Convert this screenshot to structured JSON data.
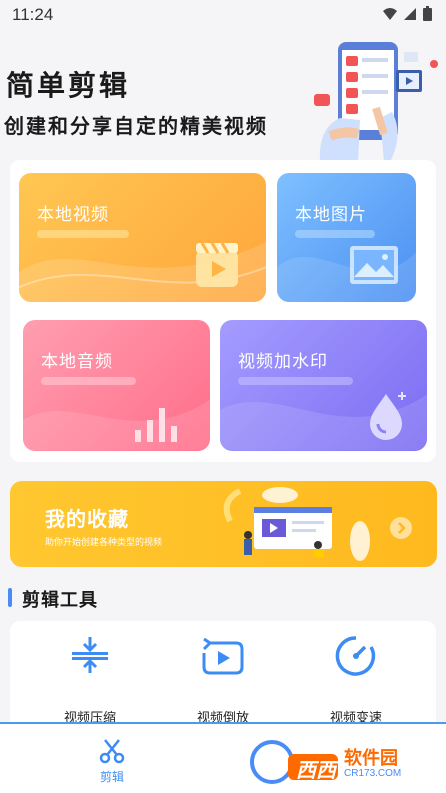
{
  "status": {
    "time": "11:24"
  },
  "hero": {
    "title": "简单剪辑",
    "subtitle": "创建和分享自定的精美视频"
  },
  "tiles": {
    "video": "本地视频",
    "image": "本地图片",
    "audio": "本地音频",
    "watermark": "视频加水印"
  },
  "favorites": {
    "title": "我的收藏",
    "desc": "助你开始创建各种类型的视频"
  },
  "tools_section": {
    "title": "剪辑工具",
    "items": [
      "视频压缩",
      "视频倒放",
      "视频变速"
    ]
  },
  "tabbar": {
    "items": [
      "剪辑"
    ]
  },
  "watermark": {
    "brand": "西西",
    "text": "软件园",
    "url": "CR173.COM"
  },
  "colors": {
    "accent": "#4a8cf7",
    "video": "#ffb444",
    "image": "#5a9cf5",
    "audio": "#ff7b95",
    "watermark": "#8d80f8",
    "favorites": "#ffc12a"
  }
}
